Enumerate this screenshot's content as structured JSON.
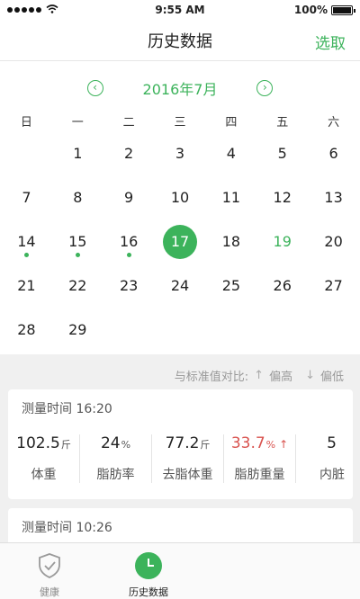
{
  "status_bar": {
    "time": "9:55 AM",
    "battery": "100%",
    "battery_level": 1.0
  },
  "nav": {
    "title": "历史数据",
    "action": "选取"
  },
  "calendar": {
    "month_label": "2016年7月",
    "prev_icon": "chevron-left-icon",
    "next_icon": "chevron-right-icon",
    "weekdays": [
      "日",
      "一",
      "二",
      "三",
      "四",
      "五",
      "六"
    ],
    "weeks": [
      [
        "",
        "1",
        "2",
        "3",
        "4",
        "5",
        "6"
      ],
      [
        "7",
        "8",
        "9",
        "10",
        "11",
        "12",
        "13"
      ],
      [
        "14",
        "15",
        "16",
        "17",
        "18",
        "19",
        "20"
      ],
      [
        "21",
        "22",
        "23",
        "24",
        "25",
        "26",
        "27"
      ],
      [
        "28",
        "29",
        "",
        "",
        "",
        "",
        ""
      ]
    ],
    "selected": "17",
    "marked_days": [
      "14",
      "15",
      "16"
    ],
    "green_days": [
      "19"
    ]
  },
  "legend": {
    "text": "与标准值对比:",
    "high": "偏高",
    "low": "偏低"
  },
  "records": [
    {
      "time": "测量时间 16:20",
      "metrics": [
        {
          "value": "102.5",
          "unit": "斤",
          "label": "体重"
        },
        {
          "value": "24",
          "unit": "%",
          "label": "脂肪率"
        },
        {
          "value": "77.2",
          "unit": "斤",
          "label": "去脂体重"
        },
        {
          "value": "33.7",
          "unit": "%",
          "label": "脂肪重量",
          "status": "high"
        },
        {
          "value": "5",
          "unit": "",
          "label": "内脏"
        }
      ]
    },
    {
      "time": "测量时间 10:26"
    }
  ],
  "tabs": [
    {
      "label": "健康",
      "icon": "shield-check-icon"
    },
    {
      "label": "历史数据",
      "icon": "clock-icon"
    }
  ],
  "colors": {
    "accent": "#3cb35b",
    "high": "#d9534f"
  }
}
